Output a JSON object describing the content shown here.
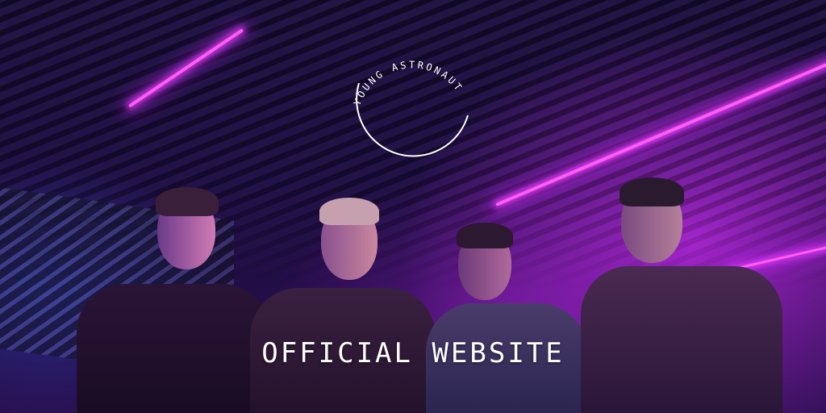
{
  "brand": {
    "name": "YOUNG ASTRONAUT"
  },
  "headline": "OFFICIAL WEBSITE",
  "colors": {
    "background": "#1a0f3a",
    "neon_accent": "#ff5cf0",
    "text": "#ffffff"
  },
  "icons": {
    "logo": "circle-logo-icon"
  }
}
